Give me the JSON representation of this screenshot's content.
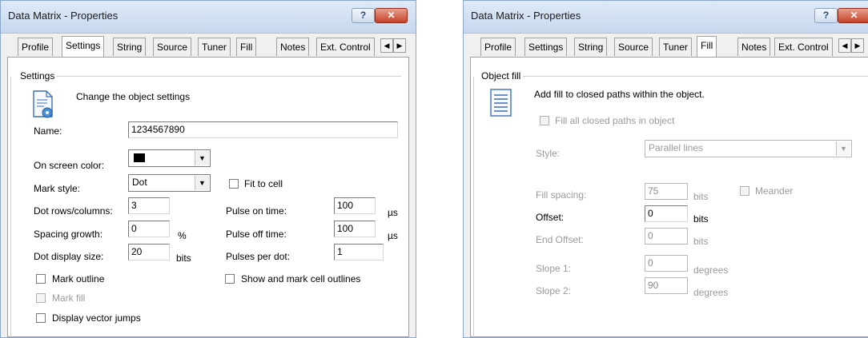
{
  "left_dialog": {
    "title": "Data Matrix - Properties",
    "help_glyph": "?",
    "close_glyph": "✕",
    "tabs": [
      "Profile",
      "Settings",
      "String",
      "Source",
      "Tuner",
      "Fill",
      "Notes",
      "Ext. Control"
    ],
    "active_tab": "Settings",
    "arrow_left": "◀",
    "arrow_right": "▶",
    "group_title": "Settings",
    "description": "Change the object settings",
    "name_label": "Name:",
    "name_value": "1234567890",
    "color_label": "On screen color:",
    "mark_style_label": "Mark style:",
    "mark_style_value": "Dot",
    "dropdown_arrow": "▼",
    "fit_to_cell_label": "Fit to cell",
    "dot_rows_label": "Dot rows/columns:",
    "dot_rows_value": "3",
    "spacing_label": "Spacing growth:",
    "spacing_value": "0",
    "spacing_unit": "%",
    "dot_size_label": "Dot display size:",
    "dot_size_value": "20",
    "dot_size_unit": "bits",
    "pulse_on_label": "Pulse on time:",
    "pulse_on_value": "100",
    "pulse_on_unit": "µs",
    "pulse_off_label": "Pulse off time:",
    "pulse_off_value": "100",
    "pulse_off_unit": "µs",
    "pulses_per_dot_label": "Pulses per dot:",
    "pulses_per_dot_value": "1",
    "mark_outline_label": "Mark outline",
    "show_cell_outlines_label": "Show and mark cell outlines",
    "mark_fill_label": "Mark fill",
    "vector_jumps_label": "Display vector jumps"
  },
  "right_dialog": {
    "title": "Data Matrix - Properties",
    "help_glyph": "?",
    "close_glyph": "✕",
    "tabs": [
      "Profile",
      "Settings",
      "String",
      "Source",
      "Tuner",
      "Fill",
      "Notes",
      "Ext. Control"
    ],
    "active_tab": "Fill",
    "arrow_left": "◀",
    "arrow_right": "▶",
    "group_title": "Object fill",
    "description": "Add fill to closed paths within the object.",
    "fill_all_label": "Fill all closed paths in object",
    "style_label": "Style:",
    "style_value": "Parallel lines",
    "dropdown_arrow": "▼",
    "fill_spacing_label": "Fill spacing:",
    "fill_spacing_value": "75",
    "fill_spacing_unit": "bits",
    "meander_label": "Meander",
    "offset_label": "Offset:",
    "offset_value": "0",
    "offset_unit": "bits",
    "end_offset_label": "End Offset:",
    "end_offset_value": "0",
    "end_offset_unit": "bits",
    "slope1_label": "Slope 1:",
    "slope1_value": "0",
    "slope1_unit": "degrees",
    "slope2_label": "Slope 2:",
    "slope2_value": "90",
    "slope2_unit": "degrees"
  }
}
